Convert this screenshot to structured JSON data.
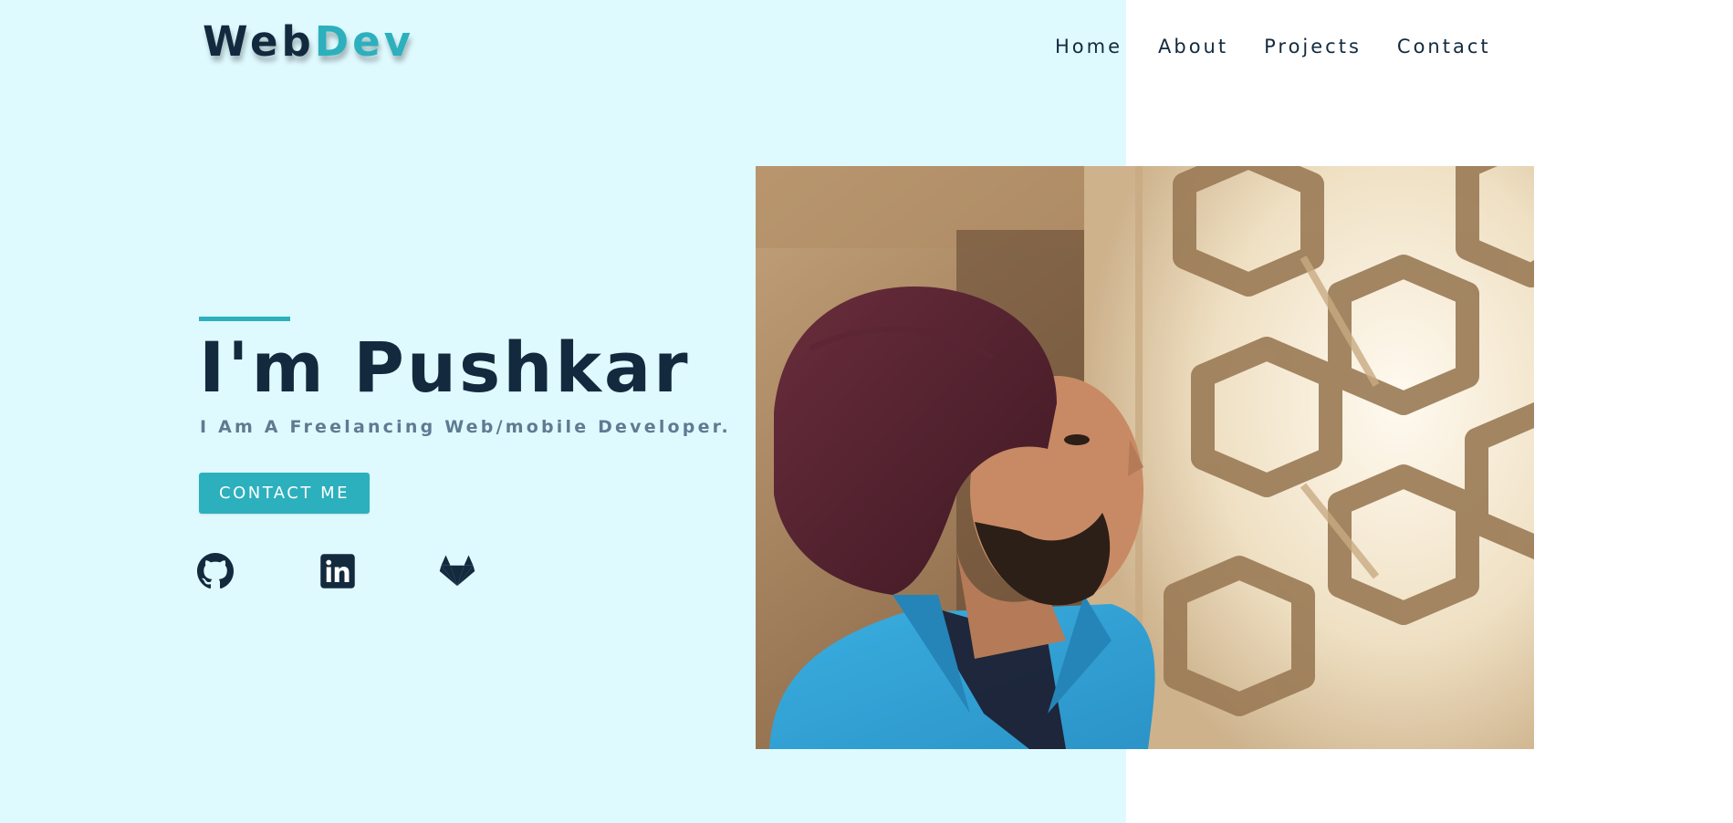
{
  "logo": {
    "part1": "Web",
    "part2": "Dev"
  },
  "nav": {
    "items": [
      {
        "label": "Home"
      },
      {
        "label": "About"
      },
      {
        "label": "Projects"
      },
      {
        "label": "Contact"
      }
    ]
  },
  "hero": {
    "title": "I'm Pushkar",
    "subtitle": "I Am A Freelancing Web/mobile Developer.",
    "button_label": "CONTACT ME"
  },
  "social": {
    "icons": [
      "github-icon",
      "linkedin-icon",
      "gitlab-icon"
    ]
  },
  "colors": {
    "accent": "#2cb0bd",
    "dark": "#132a3e",
    "muted": "#5f7b92",
    "hero_bg": "#dffaff"
  }
}
